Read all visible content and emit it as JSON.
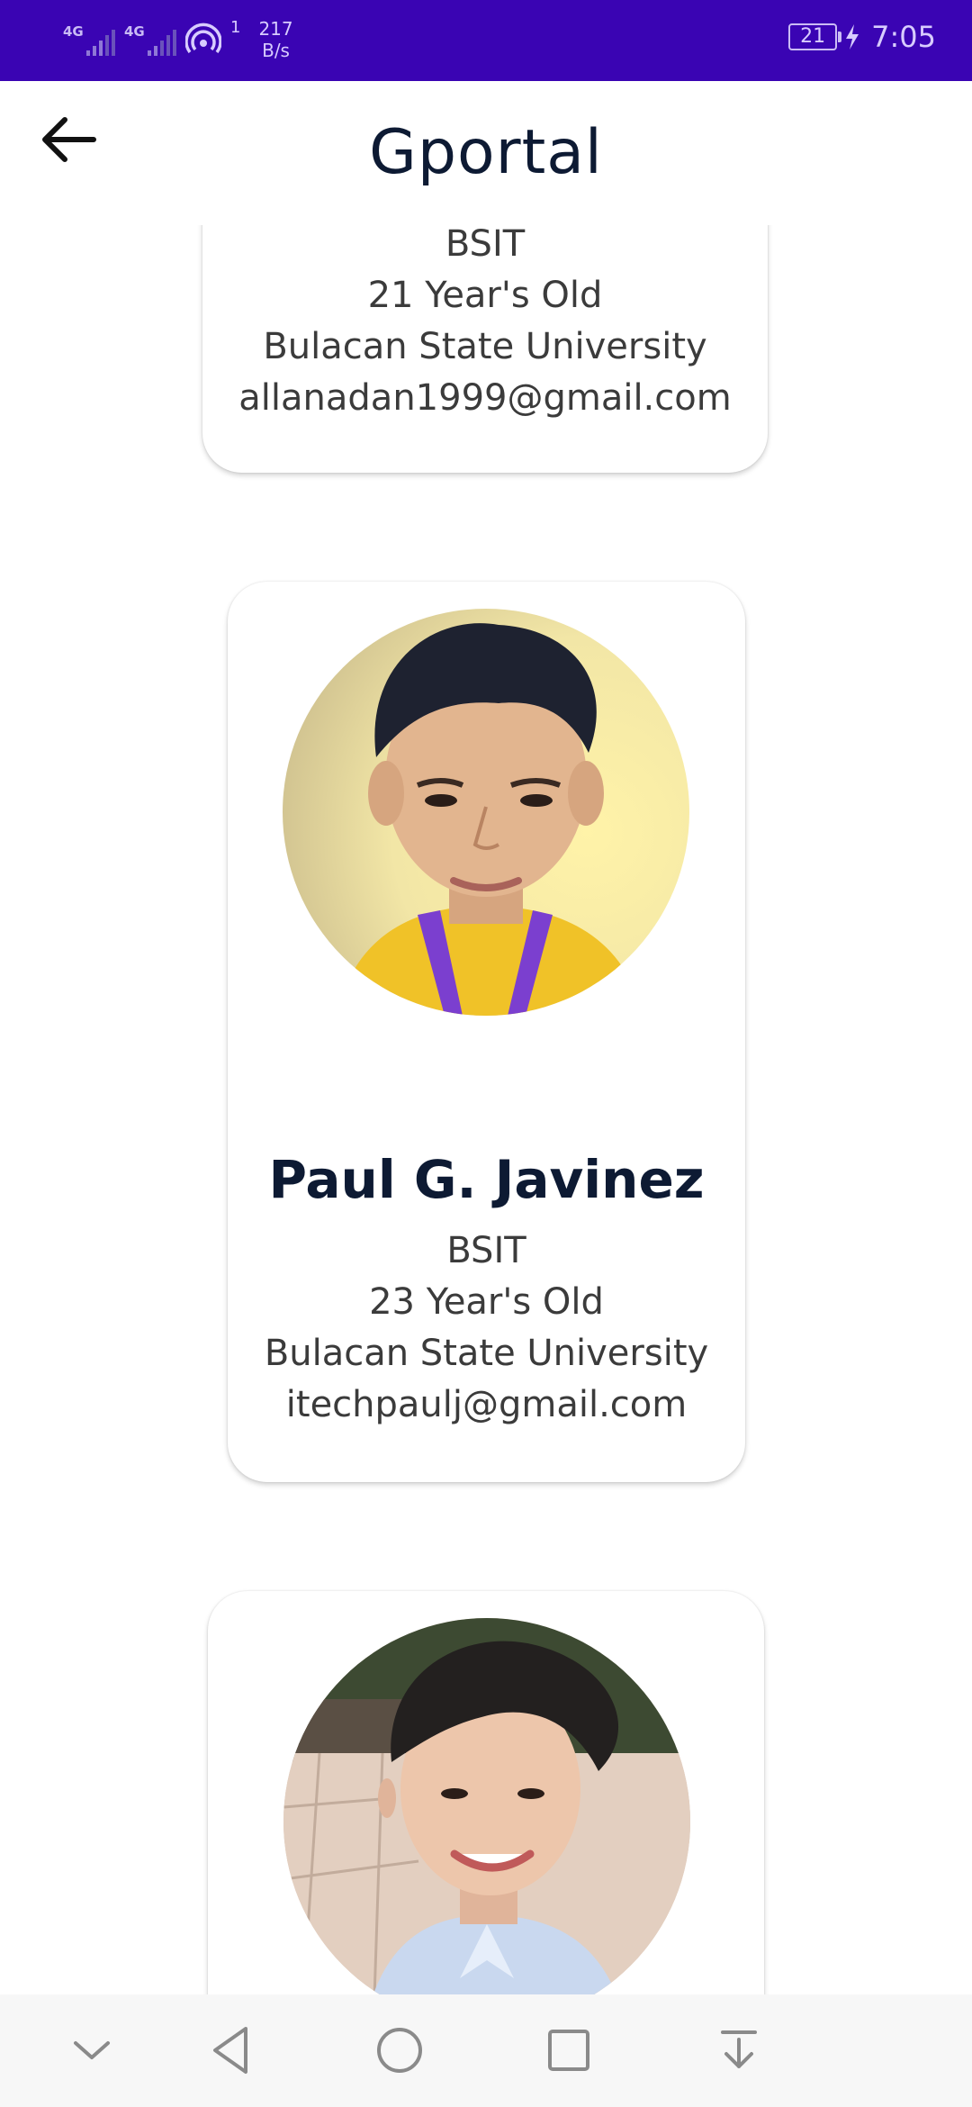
{
  "status_bar": {
    "network_1": "4G",
    "network_2": "4G",
    "hotspot_count": "1",
    "speed_value": "217",
    "speed_unit": "B/s",
    "battery": "21",
    "time": "7:05"
  },
  "app_bar": {
    "title": "Gportal"
  },
  "profiles": [
    {
      "course": "BSIT",
      "age": "21 Year's Old",
      "school": "Bulacan State University",
      "email": "allanadan1999@gmail.com"
    },
    {
      "name": "Paul G. Javinez",
      "course": "BSIT",
      "age": "23 Year's Old",
      "school": "Bulacan State University",
      "email": "itechpaulj@gmail.com"
    }
  ],
  "icons": {
    "back": "arrow-left-icon",
    "nav_collapse": "chevron-down-icon",
    "nav_back": "triangle-back-icon",
    "nav_home": "circle-home-icon",
    "nav_recents": "square-recents-icon",
    "nav_notifications": "pull-down-icon"
  },
  "colors": {
    "status_bar": "#3a04b3",
    "title_text": "#0d1a33",
    "card_bg": "#ffffff"
  }
}
